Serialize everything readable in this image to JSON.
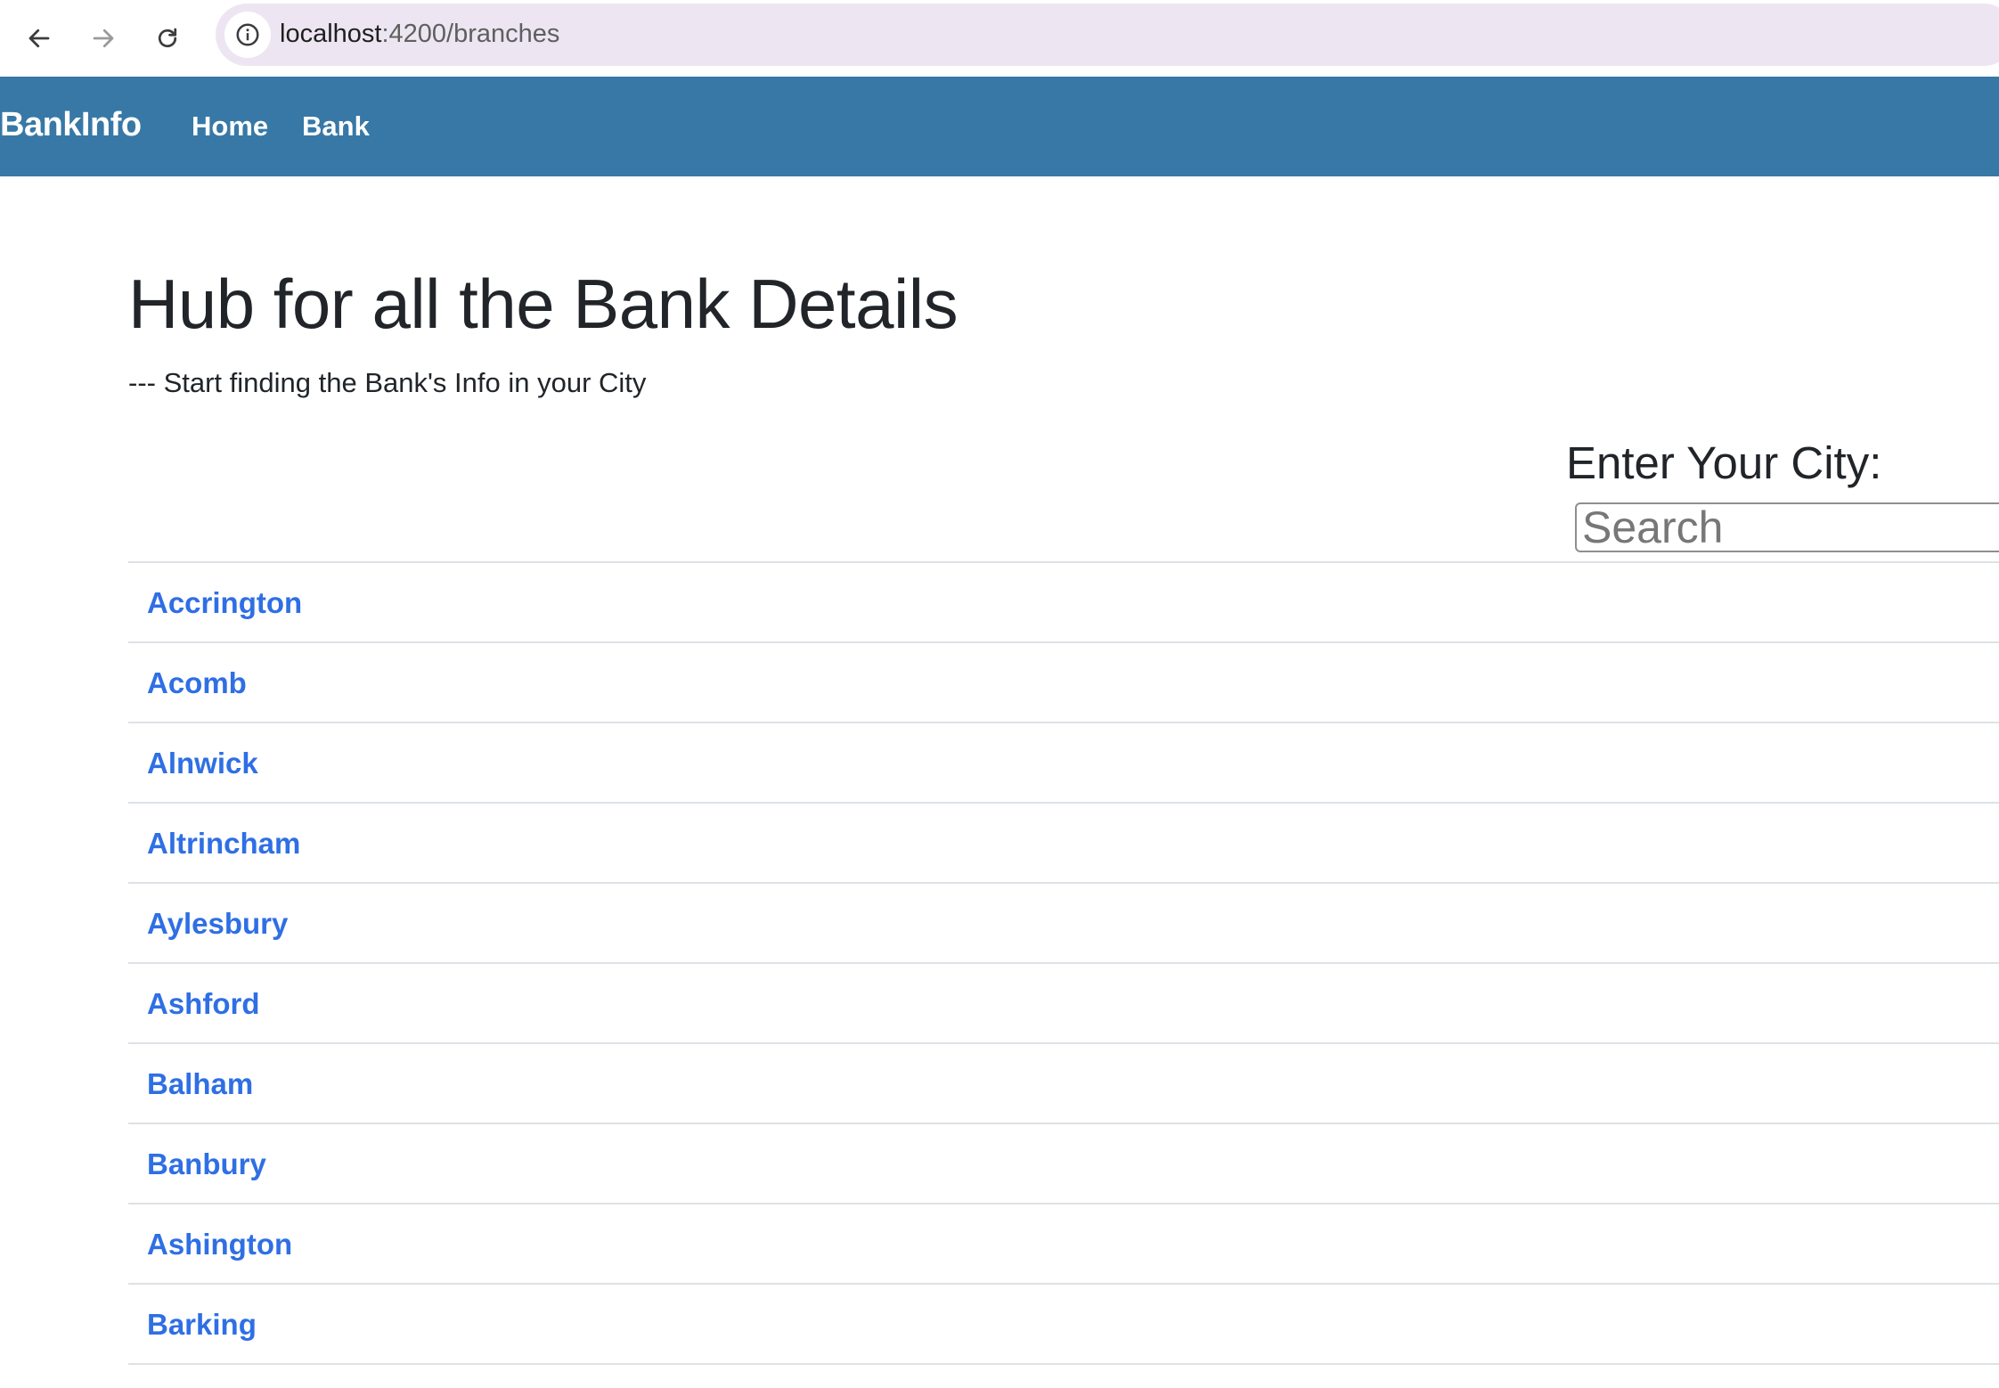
{
  "browser": {
    "url_host": "localhost",
    "url_rest": ":4200/branches",
    "back_icon": "arrow-left-icon",
    "forward_icon": "arrow-right-icon",
    "reload_icon": "reload-icon",
    "info_icon": "info-icon"
  },
  "navbar": {
    "brand": "BankInfo",
    "links": [
      "Home",
      "Bank"
    ],
    "background": "#3778a6"
  },
  "main": {
    "title": "Hub for all the Bank Details",
    "subtitle": "--- Start finding the Bank's Info in your City",
    "search_label": "Enter Your City:",
    "search_placeholder": "Search",
    "search_value": "",
    "cities": [
      "Accrington",
      "Acomb",
      "Alnwick",
      "Altrincham",
      "Aylesbury",
      "Ashford",
      "Balham",
      "Banbury",
      "Ashington",
      "Barking"
    ],
    "link_color": "#2f6fe4"
  }
}
